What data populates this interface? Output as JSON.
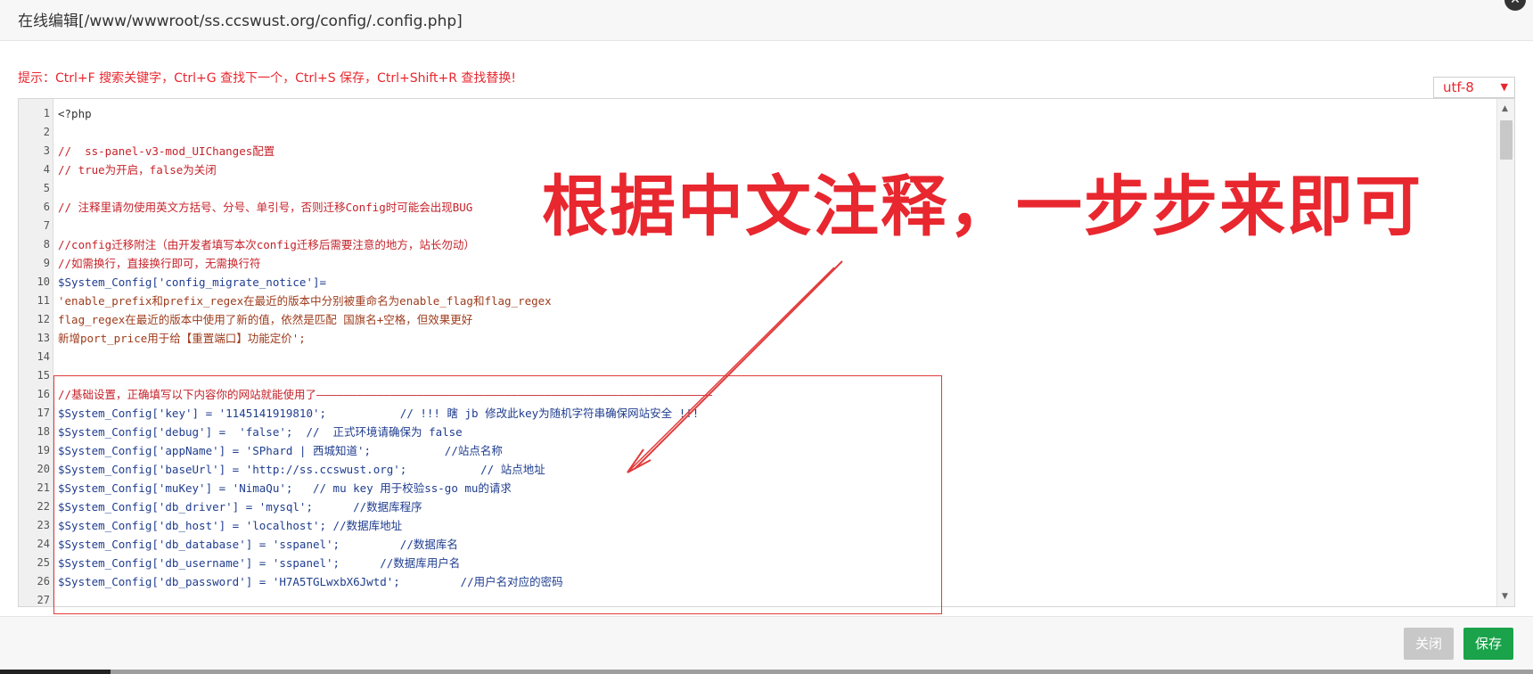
{
  "window": {
    "title": "在线编辑[/www/wwwroot/ss.ccswust.org/config/.config.php]",
    "close_icon": "close-icon"
  },
  "hint": "提示：Ctrl+F 搜索关键字，Ctrl+G 查找下一个，Ctrl+S 保存，Ctrl+Shift+R 查找替换!",
  "encoding": {
    "selected": "utf-8"
  },
  "annotation": "根据中文注释，一步步来即可",
  "editor": {
    "lines": [
      {
        "n": "1",
        "t": "<?php"
      },
      {
        "n": "2",
        "t": ""
      },
      {
        "n": "3",
        "t": "//  ss-panel-v3-mod_UIChanges配置"
      },
      {
        "n": "4",
        "t": "// true为开启，false为关闭"
      },
      {
        "n": "5",
        "t": ""
      },
      {
        "n": "6",
        "t": "// 注释里请勿使用英文方括号、分号、单引号，否则迁移Config时可能会出现BUG"
      },
      {
        "n": "7",
        "t": ""
      },
      {
        "n": "8",
        "t": "//config迁移附注（由开发者填写本次config迁移后需要注意的地方，站长勿动）"
      },
      {
        "n": "9",
        "t": "//如需换行，直接换行即可，无需换行符"
      },
      {
        "n": "10",
        "t": "$System_Config['config_migrate_notice']="
      },
      {
        "n": "11",
        "t": "'enable_prefix和prefix_regex在最近的版本中分别被重命名为enable_flag和flag_regex"
      },
      {
        "n": "12",
        "t": "flag_regex在最近的版本中使用了新的值，依然是匹配 国旗名+空格，但效果更好"
      },
      {
        "n": "13",
        "t": "新增port_price用于给【重置端口】功能定价';"
      },
      {
        "n": "14",
        "t": ""
      },
      {
        "n": "15",
        "t": ""
      },
      {
        "n": "16",
        "t": "//基础设置，正确填写以下内容你的网站就能使用了———————————————————————————————————————————————————————————"
      },
      {
        "n": "17",
        "t": "$System_Config['key'] = '1145141919810';           // !!! 瞎 jb 修改此key为随机字符串确保网站安全 !!!"
      },
      {
        "n": "18",
        "t": "$System_Config['debug'] =  'false';  //  正式环境请确保为 false"
      },
      {
        "n": "19",
        "t": "$System_Config['appName'] = 'SPhard | 西城知道';           //站点名称"
      },
      {
        "n": "20",
        "t": "$System_Config['baseUrl'] = 'http://ss.ccswust.org';           // 站点地址"
      },
      {
        "n": "21",
        "t": "$System_Config['muKey'] = 'NimaQu';   // mu key 用于校验ss-go mu的请求"
      },
      {
        "n": "22",
        "t": "$System_Config['db_driver'] = 'mysql';      //数据库程序"
      },
      {
        "n": "23",
        "t": "$System_Config['db_host'] = 'localhost'; //数据库地址"
      },
      {
        "n": "24",
        "t": "$System_Config['db_database'] = 'sspanel';         //数据库名"
      },
      {
        "n": "25",
        "t": "$System_Config['db_username'] = 'sspanel';      //数据库用户名"
      },
      {
        "n": "26",
        "t": "$System_Config['db_password'] = 'H7A5TGLwxbX6Jwtd';         //用户名对应的密码"
      },
      {
        "n": "27",
        "t": ""
      }
    ]
  },
  "footer": {
    "close_label": "关闭",
    "save_label": "保存"
  },
  "colors": {
    "accent_red": "#e8272f",
    "save_green": "#1aa34a",
    "close_gray": "#c8c8c8"
  }
}
